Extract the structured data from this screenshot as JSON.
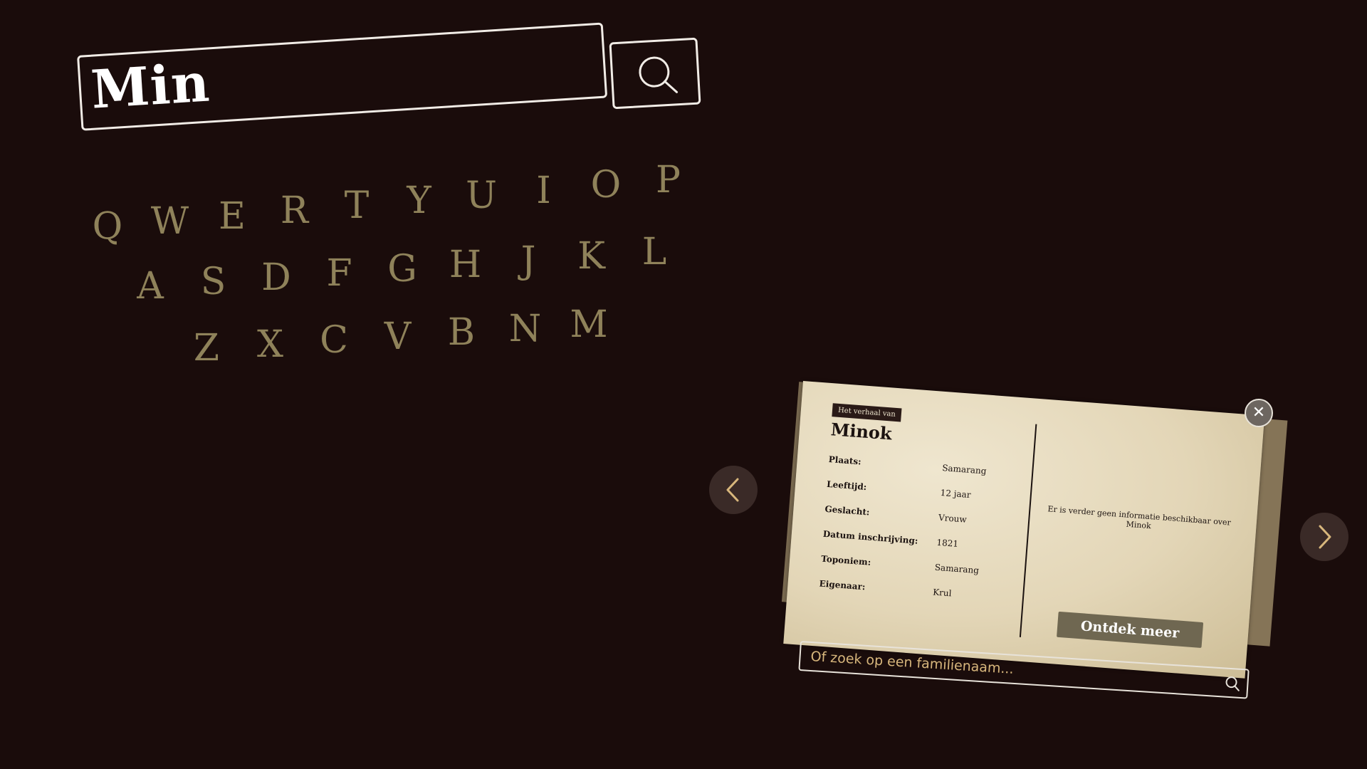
{
  "search": {
    "query": "Min"
  },
  "keyboard": {
    "row1": [
      "Q",
      "W",
      "E",
      "R",
      "T",
      "Y",
      "U",
      "I",
      "O",
      "P"
    ],
    "row2": [
      "A",
      "S",
      "D",
      "F",
      "G",
      "H",
      "J",
      "K",
      "L"
    ],
    "row3": [
      "Z",
      "X",
      "C",
      "V",
      "B",
      "N",
      "M"
    ]
  },
  "card": {
    "tag": "Het verhaal van",
    "name": "Minok",
    "fields": [
      {
        "label": "Plaats:",
        "value": "Samarang"
      },
      {
        "label": "Leeftijd:",
        "value": "12 jaar"
      },
      {
        "label": "Geslacht:",
        "value": "Vrouw"
      },
      {
        "label": "Datum  inschrijving:",
        "value": "1821"
      },
      {
        "label": "Toponiem:",
        "value": "Samarang"
      },
      {
        "label": "Eigenaar:",
        "value": "Krul"
      }
    ],
    "no_info": "Er is verder geen informatie beschikbaar over Minok",
    "discover_label": "Ontdek meer",
    "close_glyph": "✕"
  },
  "family_search": {
    "placeholder": "Of zoek op een familienaam..."
  },
  "colors": {
    "background": "#1a0c0b",
    "key": "#8f825a",
    "accent": "#d7b67c"
  }
}
